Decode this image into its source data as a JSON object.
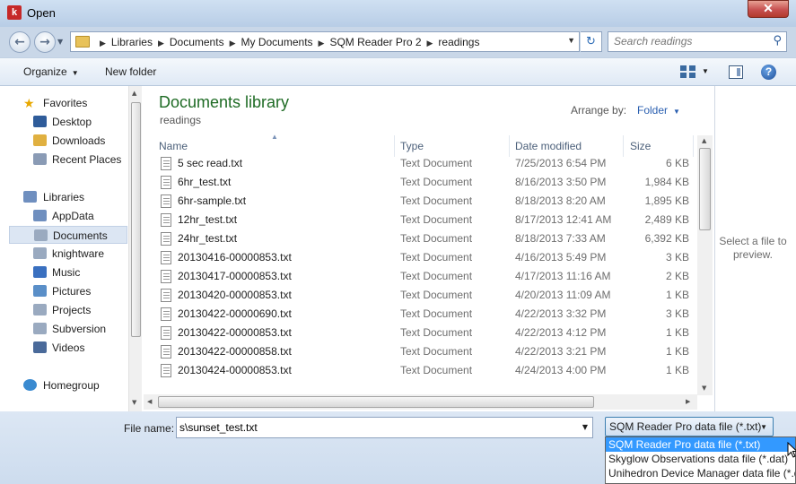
{
  "window": {
    "title": "Open",
    "app_icon_letter": "k",
    "close_label": "✕"
  },
  "address": {
    "crumbs": [
      "Libraries",
      "Documents",
      "My Documents",
      "SQM Reader Pro 2",
      "readings"
    ],
    "search_placeholder": "Search readings"
  },
  "toolbar": {
    "organize_label": "Organize",
    "new_folder_label": "New folder",
    "help_label": "?"
  },
  "nav": {
    "favorites_label": "Favorites",
    "favorites": [
      "Desktop",
      "Downloads",
      "Recent Places"
    ],
    "libraries_label": "Libraries",
    "libraries": [
      "AppData",
      "Documents",
      "knightware",
      "Music",
      "Pictures",
      "Projects",
      "Subversion",
      "Videos"
    ],
    "selected": "Documents",
    "homegroup_label": "Homegroup"
  },
  "library": {
    "title": "Documents library",
    "subtitle": "readings",
    "arrange_label": "Arrange by:",
    "arrange_value": "Folder"
  },
  "columns": {
    "name": "Name",
    "type": "Type",
    "date": "Date modified",
    "size": "Size"
  },
  "files": [
    {
      "name": "5 sec read.txt",
      "type": "Text Document",
      "date": "7/25/2013 6:54 PM",
      "size": "6 KB"
    },
    {
      "name": "6hr_test.txt",
      "type": "Text Document",
      "date": "8/16/2013 3:50 PM",
      "size": "1,984 KB"
    },
    {
      "name": "6hr-sample.txt",
      "type": "Text Document",
      "date": "8/18/2013 8:20 AM",
      "size": "1,895 KB"
    },
    {
      "name": "12hr_test.txt",
      "type": "Text Document",
      "date": "8/17/2013 12:41 AM",
      "size": "2,489 KB"
    },
    {
      "name": "24hr_test.txt",
      "type": "Text Document",
      "date": "8/18/2013 7:33 AM",
      "size": "6,392 KB"
    },
    {
      "name": "20130416-00000853.txt",
      "type": "Text Document",
      "date": "4/16/2013 5:49 PM",
      "size": "3 KB"
    },
    {
      "name": "20130417-00000853.txt",
      "type": "Text Document",
      "date": "4/17/2013 11:16 AM",
      "size": "2 KB"
    },
    {
      "name": "20130420-00000853.txt",
      "type": "Text Document",
      "date": "4/20/2013 11:09 AM",
      "size": "1 KB"
    },
    {
      "name": "20130422-00000690.txt",
      "type": "Text Document",
      "date": "4/22/2013 3:32 PM",
      "size": "3 KB"
    },
    {
      "name": "20130422-00000853.txt",
      "type": "Text Document",
      "date": "4/22/2013 4:12 PM",
      "size": "1 KB"
    },
    {
      "name": "20130422-00000858.txt",
      "type": "Text Document",
      "date": "4/22/2013 3:21 PM",
      "size": "1 KB"
    },
    {
      "name": "20130424-00000853.txt",
      "type": "Text Document",
      "date": "4/24/2013 4:00 PM",
      "size": "1 KB"
    }
  ],
  "preview": {
    "message": "Select a file to preview."
  },
  "bottom": {
    "filename_label": "File name:",
    "filename_value": "s\\sunset_test.txt",
    "filetype_value": "SQM Reader Pro data file (*.txt)",
    "filetype_options": [
      "SQM Reader Pro data file (*.txt)",
      "Skyglow Observations data file (*.dat)",
      "Unihedron Device Manager data file (*.dat)"
    ],
    "filetype_selected_index": 0
  }
}
